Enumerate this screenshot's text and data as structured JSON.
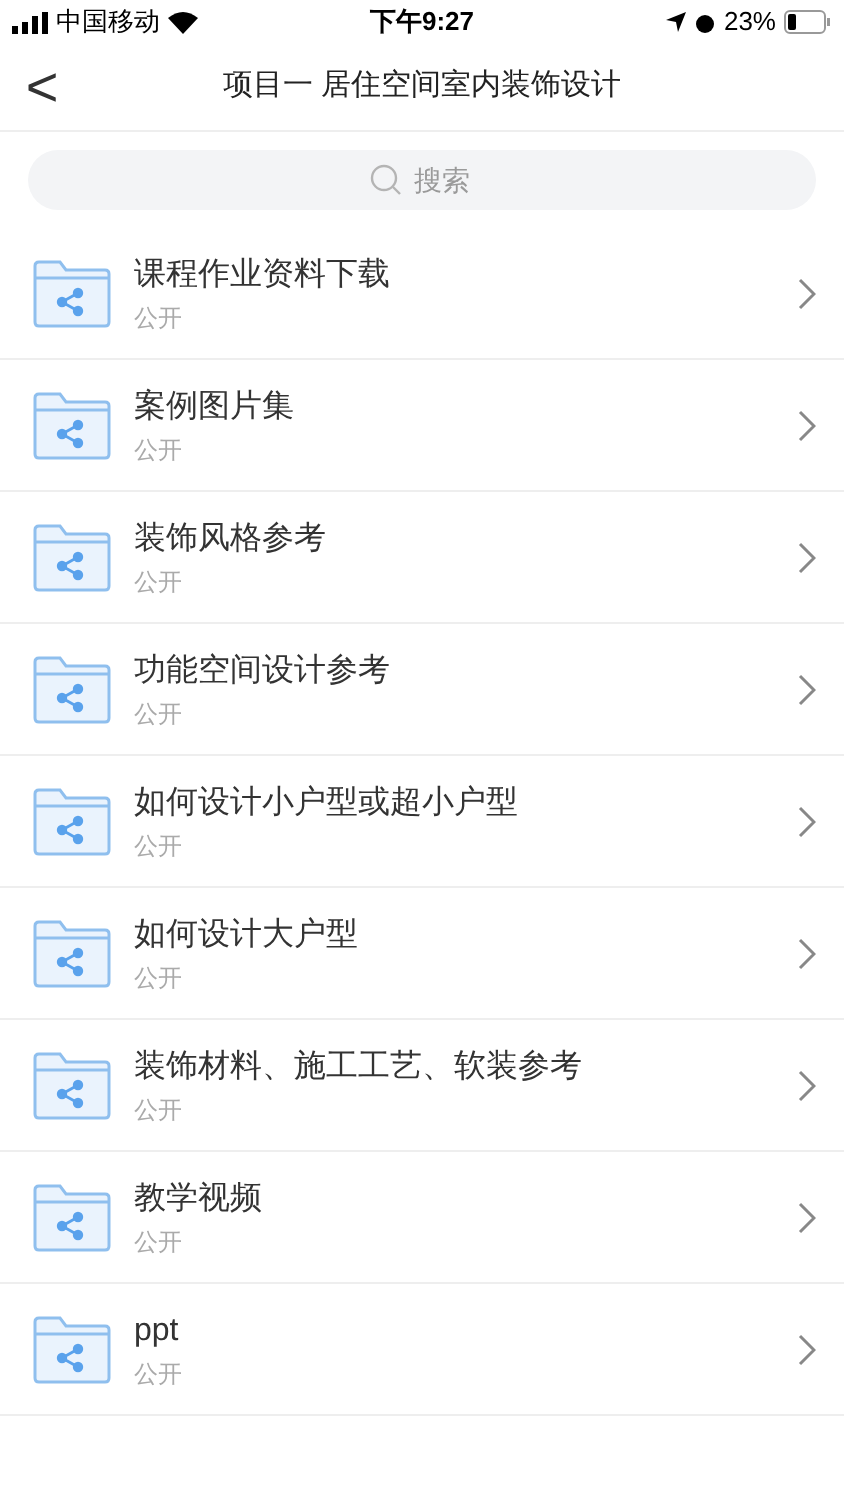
{
  "status_bar": {
    "carrier": "中国移动",
    "time": "下午9:27",
    "battery": "23%"
  },
  "nav": {
    "back": "<",
    "title": "项目一 居住空间室内装饰设计"
  },
  "search": {
    "placeholder": "搜索"
  },
  "folders": [
    {
      "name": "课程作业资料下载",
      "visibility": "公开"
    },
    {
      "name": "案例图片集",
      "visibility": "公开"
    },
    {
      "name": "装饰风格参考",
      "visibility": "公开"
    },
    {
      "name": "功能空间设计参考",
      "visibility": "公开"
    },
    {
      "name": "如何设计小户型或超小户型",
      "visibility": "公开"
    },
    {
      "name": "如何设计大户型",
      "visibility": "公开"
    },
    {
      "name": "装饰材料、施工工艺、软装参考",
      "visibility": "公开"
    },
    {
      "name": "教学视频",
      "visibility": "公开"
    },
    {
      "name": "ppt",
      "visibility": "公开"
    }
  ]
}
